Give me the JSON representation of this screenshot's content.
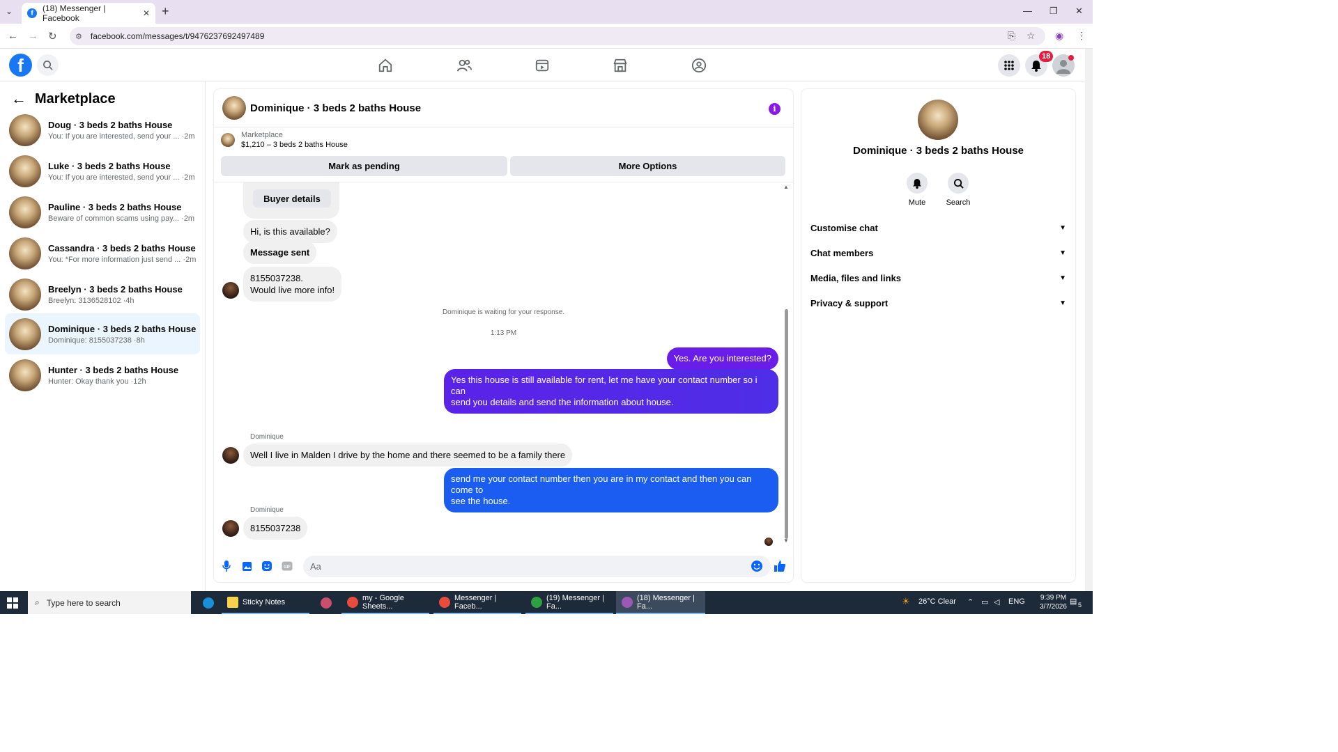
{
  "browser": {
    "tab_title": "(18) Messenger | Facebook",
    "url": "facebook.com/messages/t/9476237692497489"
  },
  "header": {
    "notifications_badge": "18"
  },
  "sidebar": {
    "title": "Marketplace",
    "conversations": [
      {
        "name": "Doug · 3 beds 2 baths House",
        "preview": "You: If you are interested, send your ... ·2m"
      },
      {
        "name": "Luke · 3 beds 2 baths House",
        "preview": "You: If you are interested, send your ... ·2m"
      },
      {
        "name": "Pauline · 3 beds 2 baths House",
        "preview": "Beware of common scams using pay... ·2m"
      },
      {
        "name": "Cassandra · 3 beds 2 baths House",
        "preview": "You: *For more information just send ... ·2m"
      },
      {
        "name": "Breelyn · 3 beds 2 baths House",
        "preview": "Breelyn: 3136528102 ·4h"
      },
      {
        "name": "Dominique · 3 beds 2 baths House",
        "preview": "Dominique: 8155037238 ·8h"
      },
      {
        "name": "Hunter · 3 beds 2 baths House",
        "preview": "Hunter: Okay thank you ·12h"
      }
    ]
  },
  "chat": {
    "title": "Dominique · 3 beds 2 baths House",
    "marketplace_label": "Marketplace",
    "listing": "$1,210 – 3 beds 2 baths House",
    "mark_pending": "Mark as pending",
    "more_options": "More Options",
    "buyer_details": "Buyer details",
    "msg_available": "Hi, is this available?",
    "msg_sent": "Message sent",
    "msg_phone_line1": "8155037238.",
    "msg_phone_line2": "Would live more info!",
    "waiting": "Dominique is waiting for your response.",
    "time": "1:13 PM",
    "out1": "Yes. Are you interested?",
    "out2_line1": "Yes this house is still available for rent, let me have your contact number so i can",
    "out2_line2": "send you details and send the information about house.",
    "sender1": "Dominique",
    "in_malden": "Well I live in Malden I drive by the home and there seemed to be a family there",
    "out3_line1": "send me your contact number then you are in my contact and then you can come to",
    "out3_line2": "see the house.",
    "sender2": "Dominique",
    "in_phone": "8155037238",
    "composer_placeholder": "Aa"
  },
  "right_panel": {
    "name": "Dominique · 3 beds 2 baths House",
    "mute": "Mute",
    "search": "Search",
    "rows": [
      "Customise chat",
      "Chat members",
      "Media, files and links",
      "Privacy & support"
    ]
  },
  "taskbar": {
    "search_placeholder": "Type here to search",
    "items": [
      "Sticky Notes",
      "my - Google Sheets...",
      "Messenger | Faceb...",
      "(19) Messenger | Fa...",
      "(18) Messenger | Fa..."
    ],
    "weather": "26°C  Clear",
    "lang": "ENG",
    "time": "9:39 PM",
    "date": "3/7/2026",
    "notif_count": "5"
  },
  "colors": {
    "accent_blue": "#1877f2",
    "bubble_purple": "#6a1ce8",
    "bubble_blue": "#1a5df0",
    "active_conv": "#ebf5ff"
  }
}
